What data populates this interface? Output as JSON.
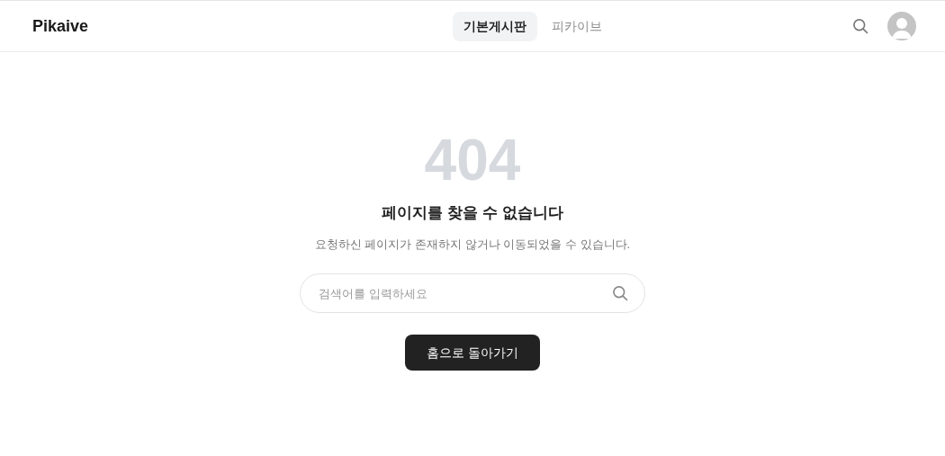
{
  "header": {
    "logo": "Pikaive",
    "tabs": [
      {
        "label": "기본게시판",
        "selected": true
      },
      {
        "label": "피카이브",
        "selected": false
      }
    ]
  },
  "error": {
    "code": "404",
    "title": "페이지를 찾을 수 없습니다",
    "message": "요청하신 페이지가 존재하지 않거나 이동되었을 수 있습니다."
  },
  "search": {
    "placeholder": "검색어를 입력하세요"
  },
  "home_button": "홈으로 돌아가기"
}
